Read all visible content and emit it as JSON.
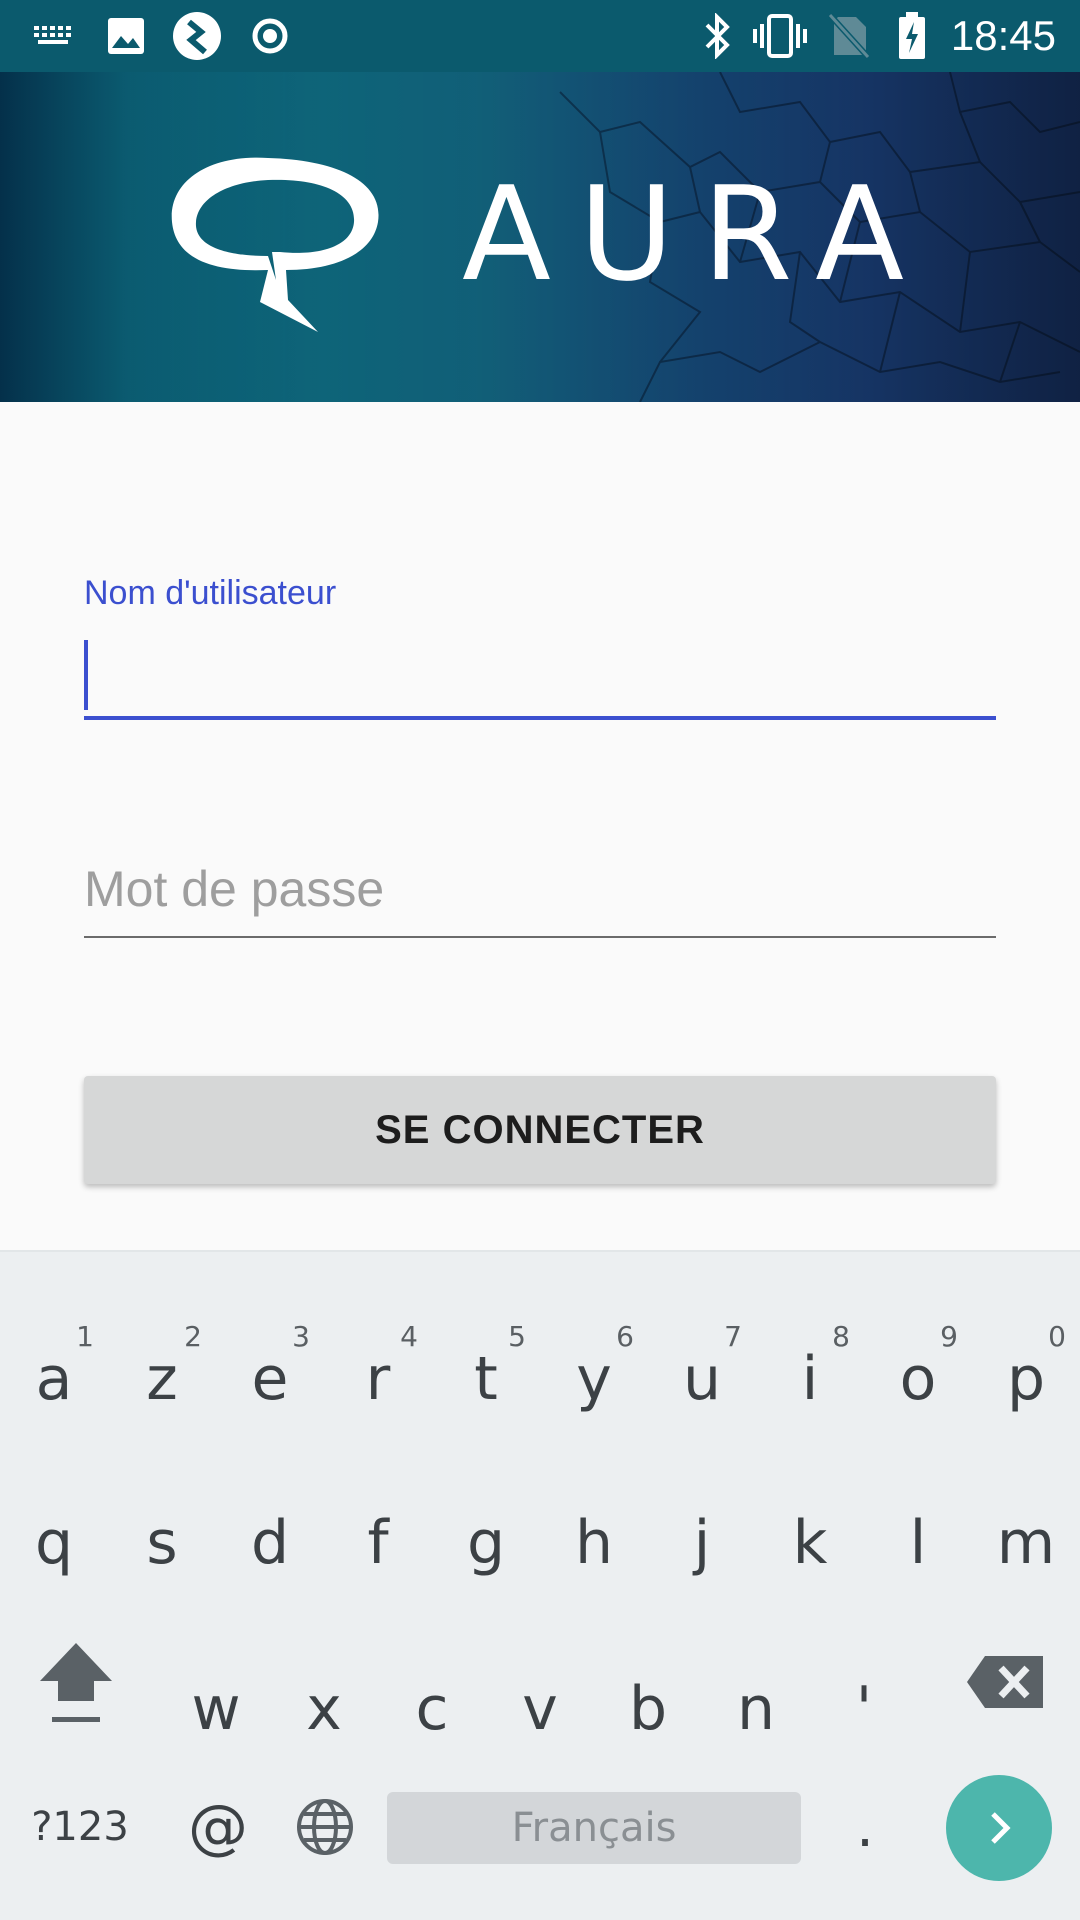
{
  "status_bar": {
    "time": "18:45",
    "icons": [
      "keyboard-icon",
      "image-icon",
      "android-debug-icon",
      "record-icon",
      "bluetooth-icon",
      "vibrate-icon",
      "no-sim-icon",
      "battery-charging-icon"
    ]
  },
  "banner": {
    "app_name": "AURA"
  },
  "form": {
    "username_label": "Nom d'utilisateur",
    "username_value": "",
    "password_placeholder": "Mot de passe",
    "login_button": "SE CONNECTER"
  },
  "keyboard": {
    "row1": [
      {
        "char": "a",
        "hint": "1"
      },
      {
        "char": "z",
        "hint": "2"
      },
      {
        "char": "e",
        "hint": "3"
      },
      {
        "char": "r",
        "hint": "4"
      },
      {
        "char": "t",
        "hint": "5"
      },
      {
        "char": "y",
        "hint": "6"
      },
      {
        "char": "u",
        "hint": "7"
      },
      {
        "char": "i",
        "hint": "8"
      },
      {
        "char": "o",
        "hint": "9"
      },
      {
        "char": "p",
        "hint": "0"
      }
    ],
    "row2": [
      "q",
      "s",
      "d",
      "f",
      "g",
      "h",
      "j",
      "k",
      "l",
      "m"
    ],
    "row3": [
      "w",
      "x",
      "c",
      "v",
      "b",
      "n",
      "'"
    ],
    "symbols_label": "?123",
    "at_label": "@",
    "space_label": "Français",
    "period_label": "."
  },
  "colors": {
    "status_bar": "#0b5a6d",
    "accent": "#3b4fcf",
    "button": "#d6d7d7",
    "enter_key": "#4db6ac"
  }
}
